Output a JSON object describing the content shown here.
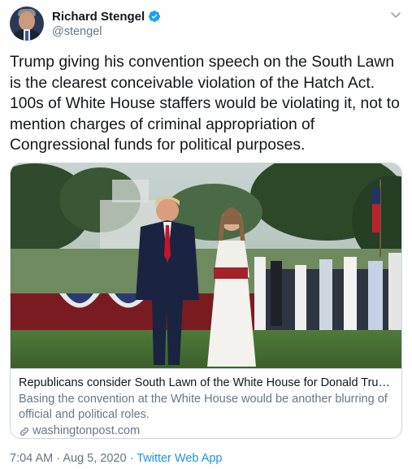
{
  "author": {
    "display_name": "Richard Stengel",
    "handle": "@stengel",
    "verified": true
  },
  "tweet": {
    "text": "Trump giving his convention speech on the South Lawn is the clearest conceivable violation of the Hatch Act. 100s of White House staffers would be violating it, not to mention charges of criminal appropriation of Congressional funds for political purposes."
  },
  "card": {
    "title": "Republicans consider South Lawn of the White House for Donald Trump’s c...",
    "description": "Basing the convention at the White House would be another blurring of official and political roles.",
    "domain": "washingtonpost.com"
  },
  "meta": {
    "time": "7:04 AM",
    "separator": "·",
    "date": "Aug 5, 2020",
    "source_app": "Twitter Web App"
  },
  "colors": {
    "link_blue": "#1b95e0",
    "secondary_text": "#657786",
    "border": "#ccd6dd",
    "verified_badge": "#1da1f2"
  },
  "icons": [
    "verified-badge-icon",
    "chevron-down-icon",
    "link-icon"
  ]
}
